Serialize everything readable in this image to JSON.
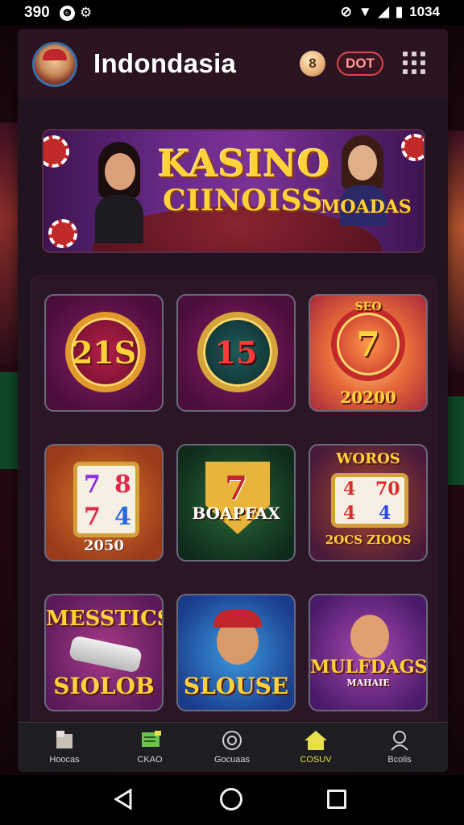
{
  "status_bar": {
    "time": "390",
    "badge_icon": "circle-badge-icon",
    "notif_icon": "settings-circle-icon",
    "battery_label": "1034",
    "icons": [
      "mute-icon",
      "wifi-icon",
      "signal-icon",
      "battery-icon"
    ]
  },
  "header": {
    "title": "Indondasia",
    "coin_label": "8",
    "pill_label": "DOT"
  },
  "banner": {
    "line1": "KASINO",
    "line2": "CIINOISS",
    "line3": "MOADAS"
  },
  "games": [
    {
      "label": "21S"
    },
    {
      "label": "15"
    },
    {
      "label": "7",
      "sub": "20200",
      "top": "SEO"
    },
    {
      "label": "2050",
      "reels": [
        "7",
        "8",
        "7",
        "4"
      ]
    },
    {
      "label": "BOAPFAX",
      "symbol": "7"
    },
    {
      "label": "2OCS ZIOOS",
      "top": "WOROS",
      "reels": [
        "4",
        "70",
        "4",
        "4"
      ]
    },
    {
      "label": "SIOLOB",
      "top": "MESSTICS"
    },
    {
      "label": "SLOUSE"
    },
    {
      "label": "MULFDAGS",
      "sub": "MAHAIE"
    }
  ],
  "nav": [
    {
      "label": "Hoocas",
      "icon": "home-cube-icon"
    },
    {
      "label": "CKAO",
      "icon": "chat-icon"
    },
    {
      "label": "Gocuaas",
      "icon": "search-icon"
    },
    {
      "label": "COSUV",
      "icon": "home-icon",
      "active": true
    },
    {
      "label": "Bcolis",
      "icon": "profile-icon"
    }
  ],
  "colors": {
    "accent_gold": "#ffd23a",
    "nav_active": "#e8e04a",
    "pill_red": "#e0454e"
  }
}
